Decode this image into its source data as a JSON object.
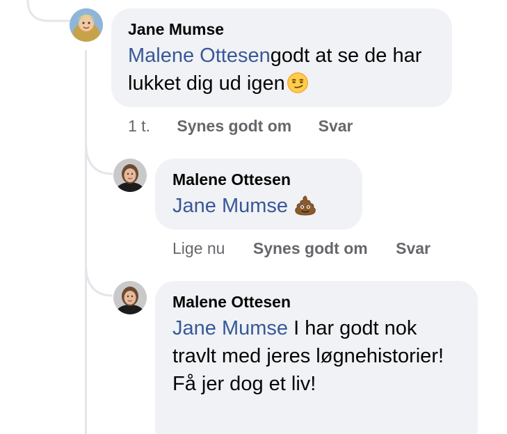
{
  "comments": [
    {
      "author": "Jane Mumse",
      "mention": "Malene Ottesen",
      "text": "godt at se de har lukket dig ud igen",
      "emoji": "smirking-face-emoji",
      "time": "1 t.",
      "like_label": "Synes godt om",
      "reply_label": "Svar"
    },
    {
      "author": "Malene Ottesen",
      "mention": "Jane Mumse",
      "text": "",
      "emoji": "pile-of-poo-emoji",
      "time": "Lige nu",
      "like_label": "Synes godt om",
      "reply_label": "Svar"
    },
    {
      "author": "Malene Ottesen",
      "mention": "Jane Mumse",
      "text": "I har godt nok travlt med jeres løgnehistorier! Få jer dog et liv!"
    }
  ],
  "colors": {
    "bubble": "#f0f2f5",
    "mention": "#385898",
    "meta": "#65676b",
    "thread_line": "#e4e6eb"
  }
}
